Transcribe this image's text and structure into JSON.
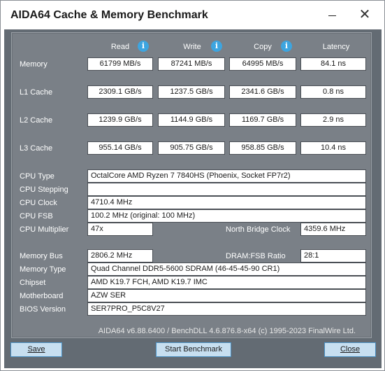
{
  "window": {
    "title": "AIDA64 Cache & Memory Benchmark"
  },
  "columns": [
    "Read",
    "Write",
    "Copy",
    "Latency"
  ],
  "bench_rows": [
    {
      "label": "Memory",
      "read": "61799 MB/s",
      "write": "87241 MB/s",
      "copy": "64995 MB/s",
      "latency": "84.1 ns"
    },
    {
      "label": "L1 Cache",
      "read": "2309.1 GB/s",
      "write": "1237.5 GB/s",
      "copy": "2341.6 GB/s",
      "latency": "0.8 ns"
    },
    {
      "label": "L2 Cache",
      "read": "1239.9 GB/s",
      "write": "1144.9 GB/s",
      "copy": "1169.7 GB/s",
      "latency": "2.9 ns"
    },
    {
      "label": "L3 Cache",
      "read": "955.14 GB/s",
      "write": "905.75 GB/s",
      "copy": "958.85 GB/s",
      "latency": "10.4 ns"
    }
  ],
  "cpu": {
    "type_label": "CPU Type",
    "type_value": "OctalCore AMD Ryzen 7 7840HS  (Phoenix, Socket FP7r2)",
    "stepping_label": "CPU Stepping",
    "stepping_value": "",
    "clock_label": "CPU Clock",
    "clock_value": "4710.4 MHz",
    "fsb_label": "CPU FSB",
    "fsb_value": "100.2 MHz  (original: 100 MHz)",
    "multiplier_label": "CPU Multiplier",
    "multiplier_value": "47x",
    "nb_clock_label": "North Bridge Clock",
    "nb_clock_value": "4359.6 MHz"
  },
  "memory": {
    "bus_label": "Memory Bus",
    "bus_value": "2806.2 MHz",
    "ratio_label": "DRAM:FSB Ratio",
    "ratio_value": "28:1",
    "type_label": "Memory Type",
    "type_value": "Quad Channel DDR5-5600 SDRAM  (46-45-45-90 CR1)",
    "chipset_label": "Chipset",
    "chipset_value": "AMD K19.7 FCH, AMD K19.7 IMC",
    "motherboard_label": "Motherboard",
    "motherboard_value": "AZW SER",
    "bios_label": "BIOS Version",
    "bios_value": "SER7PRO_P5C8V27"
  },
  "footer": "AIDA64 v6.88.6400 / BenchDLL 4.6.876.8-x64  (c) 1995-2023 FinalWire Ltd.",
  "buttons": {
    "save": "Save",
    "start": "Start Benchmark",
    "close": "Close"
  },
  "icons": {
    "info": "info-icon",
    "minimize": "minimize-icon",
    "close": "close-icon"
  }
}
